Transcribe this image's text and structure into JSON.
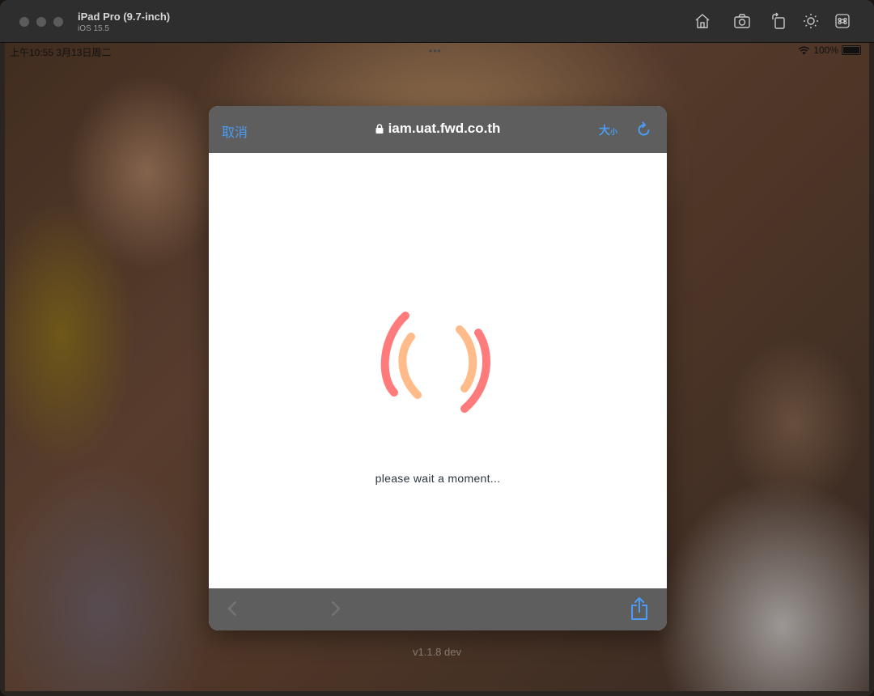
{
  "simulator": {
    "device_name": "iPad Pro (9.7-inch)",
    "os_version": "iOS 15.5",
    "toolbar_icons": [
      "home-icon",
      "screenshot-icon",
      "rotate-icon",
      "appearance-icon",
      "command-icon"
    ]
  },
  "status_bar": {
    "time_date": "上午10:55   3月13日周二",
    "more_indicator": "•••",
    "battery_percent": "100%"
  },
  "browser_modal": {
    "cancel_label": "取消",
    "url": "iam.uat.fwd.co.th",
    "text_size_label": "大",
    "text_size_small": "小",
    "loading_message": "please wait a moment...",
    "colors": {
      "accent": "#4a9cf5",
      "spinner_outer": "#ff7b7b",
      "spinner_inner": "#ffbb8a",
      "bar": "#5e5e5e"
    }
  },
  "app": {
    "version_label": "v1.1.8 dev"
  }
}
